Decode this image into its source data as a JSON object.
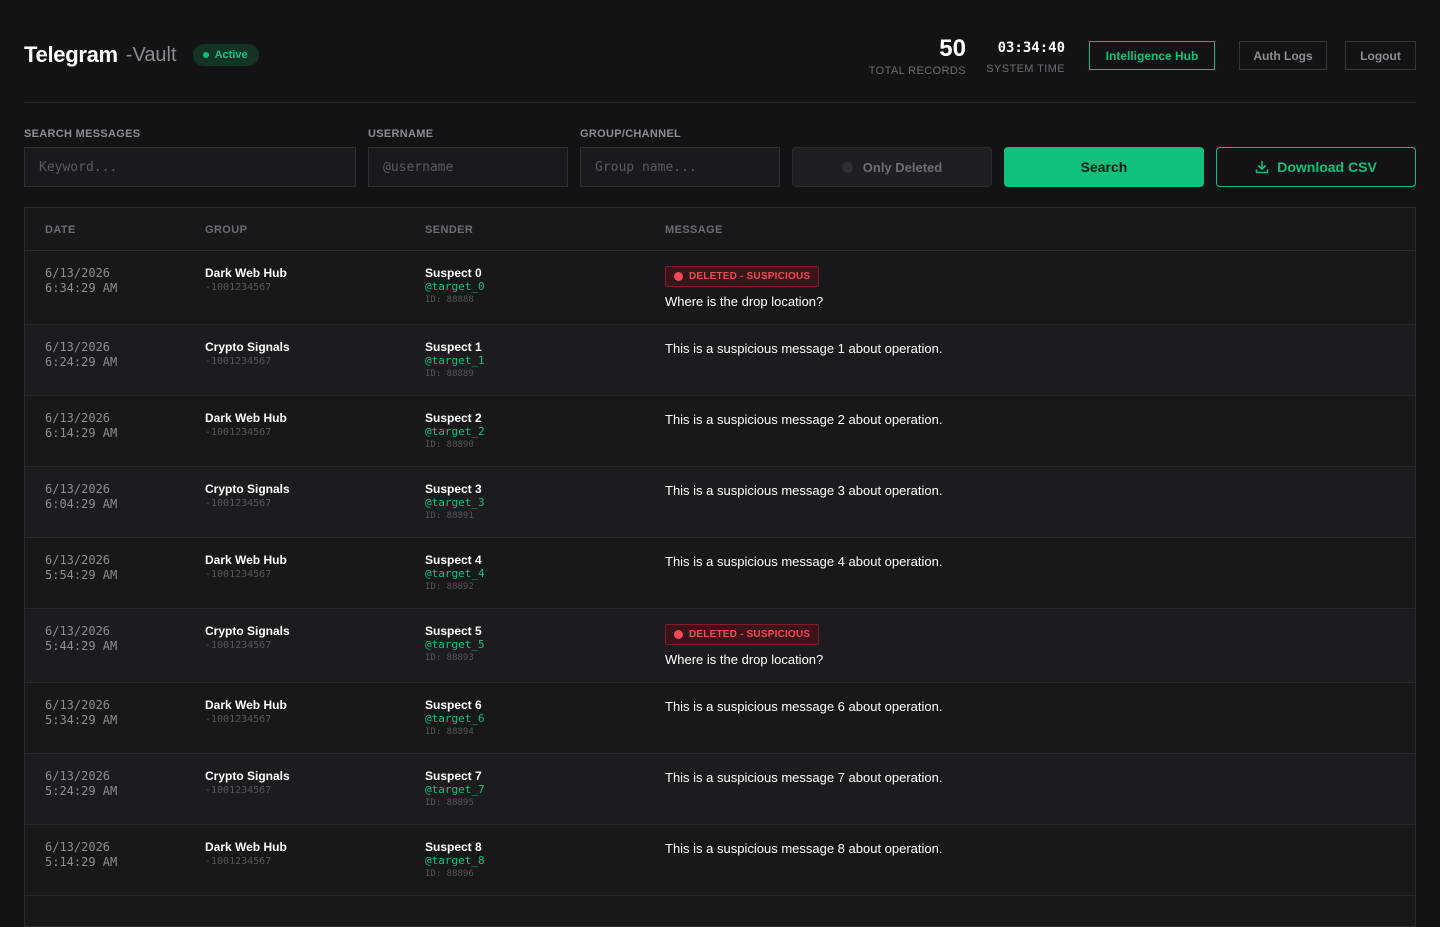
{
  "header": {
    "brand": "Telegram",
    "brand_suffix": "-Vault",
    "status": "Active",
    "total_records_value": "50",
    "total_records_label": "TOTAL RECORDS",
    "system_time_value": "03:34:40",
    "system_time_label": "SYSTEM TIME",
    "intelligence_hub_label": "Intelligence Hub",
    "auth_logs_label": "Auth Logs",
    "logout_label": "Logout"
  },
  "filters": {
    "search_label": "SEARCH MESSAGES",
    "search_placeholder": "Keyword...",
    "username_label": "USERNAME",
    "username_placeholder": "@username",
    "group_label": "GROUP/CHANNEL",
    "group_placeholder": "Group name...",
    "only_deleted_label": "Only Deleted",
    "search_button": "Search",
    "csv_button": "Download CSV"
  },
  "table": {
    "columns": [
      "DATE",
      "GROUP",
      "SENDER",
      "MESSAGE"
    ],
    "rows": [
      {
        "date": "6/13/2026",
        "time": "6:34:29 AM",
        "group": "Dark Web Hub",
        "group_id": "-1001234567",
        "sender": "Suspect 0",
        "username": "@target_0",
        "sender_id": "ID: 88888",
        "badge": "DELETED - SUSPICIOUS",
        "message": "Where is the drop location?"
      },
      {
        "date": "6/13/2026",
        "time": "6:24:29 AM",
        "group": "Crypto Signals",
        "group_id": "-1001234567",
        "sender": "Suspect 1",
        "username": "@target_1",
        "sender_id": "ID: 88889",
        "badge": "",
        "message": "This is a suspicious message 1 about operation."
      },
      {
        "date": "6/13/2026",
        "time": "6:14:29 AM",
        "group": "Dark Web Hub",
        "group_id": "-1001234567",
        "sender": "Suspect 2",
        "username": "@target_2",
        "sender_id": "ID: 88890",
        "badge": "",
        "message": "This is a suspicious message 2 about operation."
      },
      {
        "date": "6/13/2026",
        "time": "6:04:29 AM",
        "group": "Crypto Signals",
        "group_id": "-1001234567",
        "sender": "Suspect 3",
        "username": "@target_3",
        "sender_id": "ID: 88891",
        "badge": "",
        "message": "This is a suspicious message 3 about operation."
      },
      {
        "date": "6/13/2026",
        "time": "5:54:29 AM",
        "group": "Dark Web Hub",
        "group_id": "-1001234567",
        "sender": "Suspect 4",
        "username": "@target_4",
        "sender_id": "ID: 88892",
        "badge": "",
        "message": "This is a suspicious message 4 about operation."
      },
      {
        "date": "6/13/2026",
        "time": "5:44:29 AM",
        "group": "Crypto Signals",
        "group_id": "-1001234567",
        "sender": "Suspect 5",
        "username": "@target_5",
        "sender_id": "ID: 88893",
        "badge": "DELETED - SUSPICIOUS",
        "message": "Where is the drop location?"
      },
      {
        "date": "6/13/2026",
        "time": "5:34:29 AM",
        "group": "Dark Web Hub",
        "group_id": "-1001234567",
        "sender": "Suspect 6",
        "username": "@target_6",
        "sender_id": "ID: 88894",
        "badge": "",
        "message": "This is a suspicious message 6 about operation."
      },
      {
        "date": "6/13/2026",
        "time": "5:24:29 AM",
        "group": "Crypto Signals",
        "group_id": "-1001234567",
        "sender": "Suspect 7",
        "username": "@target_7",
        "sender_id": "ID: 88895",
        "badge": "",
        "message": "This is a suspicious message 7 about operation."
      },
      {
        "date": "6/13/2026",
        "time": "5:14:29 AM",
        "group": "Dark Web Hub",
        "group_id": "-1001234567",
        "sender": "Suspect 8",
        "username": "@target_8",
        "sender_id": "ID: 88896",
        "badge": "",
        "message": "This is a suspicious message 8 about operation."
      }
    ]
  },
  "colors": {
    "accent": "#10c07c",
    "danger": "#ef4a5a",
    "background": "#131316"
  },
  "icons": {
    "csv": "download-icon",
    "status": "status-dot-icon",
    "badge": "alert-dot-icon"
  }
}
